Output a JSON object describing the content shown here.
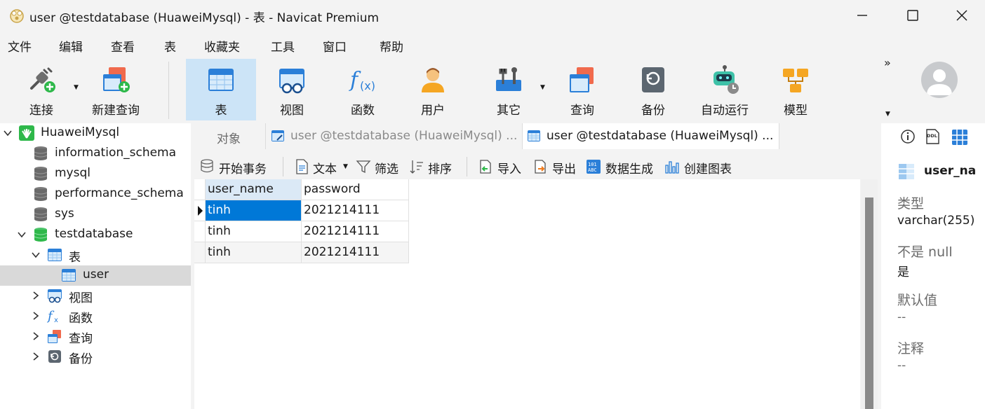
{
  "window": {
    "title": "user @testdatabase (HuaweiMysql) - 表 - Navicat Premium"
  },
  "menu": [
    "文件",
    "编辑",
    "查看",
    "表",
    "收藏夹",
    "工具",
    "窗口",
    "帮助"
  ],
  "toolbar": {
    "buttons": [
      "连接",
      "新建查询",
      "表",
      "视图",
      "函数",
      "用户",
      "其它",
      "查询",
      "备份",
      "自动运行",
      "模型"
    ],
    "more": "»"
  },
  "tree": [
    {
      "label": "HuaweiMysql"
    },
    {
      "label": "information_schema"
    },
    {
      "label": "mysql"
    },
    {
      "label": "performance_schema"
    },
    {
      "label": "sys"
    },
    {
      "label": "testdatabase"
    },
    {
      "label": "表"
    },
    {
      "label": "user"
    },
    {
      "label": "视图"
    },
    {
      "label": "函数"
    },
    {
      "label": "查询"
    },
    {
      "label": "备份"
    }
  ],
  "tabs": [
    {
      "label": "对象"
    },
    {
      "label": "user @testdatabase (HuaweiMysql) ..."
    },
    {
      "label": "user @testdatabase (HuaweiMysql) ..."
    }
  ],
  "objbar": {
    "begin_tx": "开始事务",
    "text": "文本",
    "filter": "筛选",
    "sort": "排序",
    "import": "导入",
    "export": "导出",
    "datagen": "数据生成",
    "chart": "创建图表"
  },
  "grid": {
    "columns": [
      "user_name",
      "password"
    ],
    "rows": [
      [
        "tinh",
        "2021214111"
      ],
      [
        "tinh",
        "2021214111"
      ],
      [
        "tinh",
        "2021214111"
      ]
    ]
  },
  "info": {
    "field_name": "user_na",
    "type_label": "类型",
    "type_value": "varchar(255)",
    "notnull_label": "不是 null",
    "notnull_value": "是",
    "default_label": "默认值",
    "default_value": "--",
    "comment_label": "注释",
    "comment_value": "--",
    "ddl_badge": "DDL"
  },
  "colors": {
    "accent": "#0078d7",
    "selected_row": "#0078d7",
    "active_tool": "#cce4f7"
  }
}
